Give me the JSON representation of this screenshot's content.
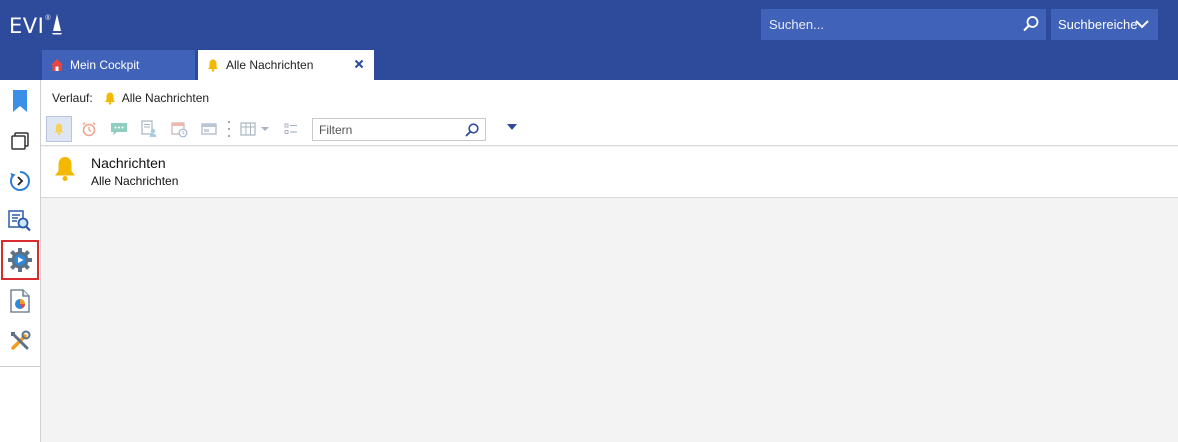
{
  "app": {
    "logo_text": "EVI",
    "logo_mark": "®"
  },
  "search": {
    "placeholder": "Suchen...",
    "scope_label": "Suchbereiche"
  },
  "tabs": [
    {
      "label": "Mein Cockpit",
      "icon": "home-icon",
      "active": false
    },
    {
      "label": "Alle Nachrichten",
      "icon": "bell-icon",
      "active": true
    }
  ],
  "sidebar": {
    "items": [
      {
        "name": "bookmark-icon"
      },
      {
        "name": "windows-icon"
      },
      {
        "name": "history-icon"
      },
      {
        "name": "report-search-icon"
      },
      {
        "name": "process-gear-icon",
        "selected": true
      },
      {
        "name": "document-chart-icon"
      },
      {
        "name": "tools-icon"
      }
    ]
  },
  "breadcrumb": {
    "prefix": "Verlauf:",
    "current": "Alle Nachrichten"
  },
  "toolbar": {
    "filter_placeholder": "Filtern"
  },
  "list": [
    {
      "title": "Nachrichten",
      "subtitle": "Alle Nachrichten",
      "icon": "bell-icon"
    }
  ],
  "colors": {
    "header": "#2e4a9b",
    "header_control": "#4062b8",
    "accent_red": "#d92b2b",
    "bell": "#f5b800"
  }
}
